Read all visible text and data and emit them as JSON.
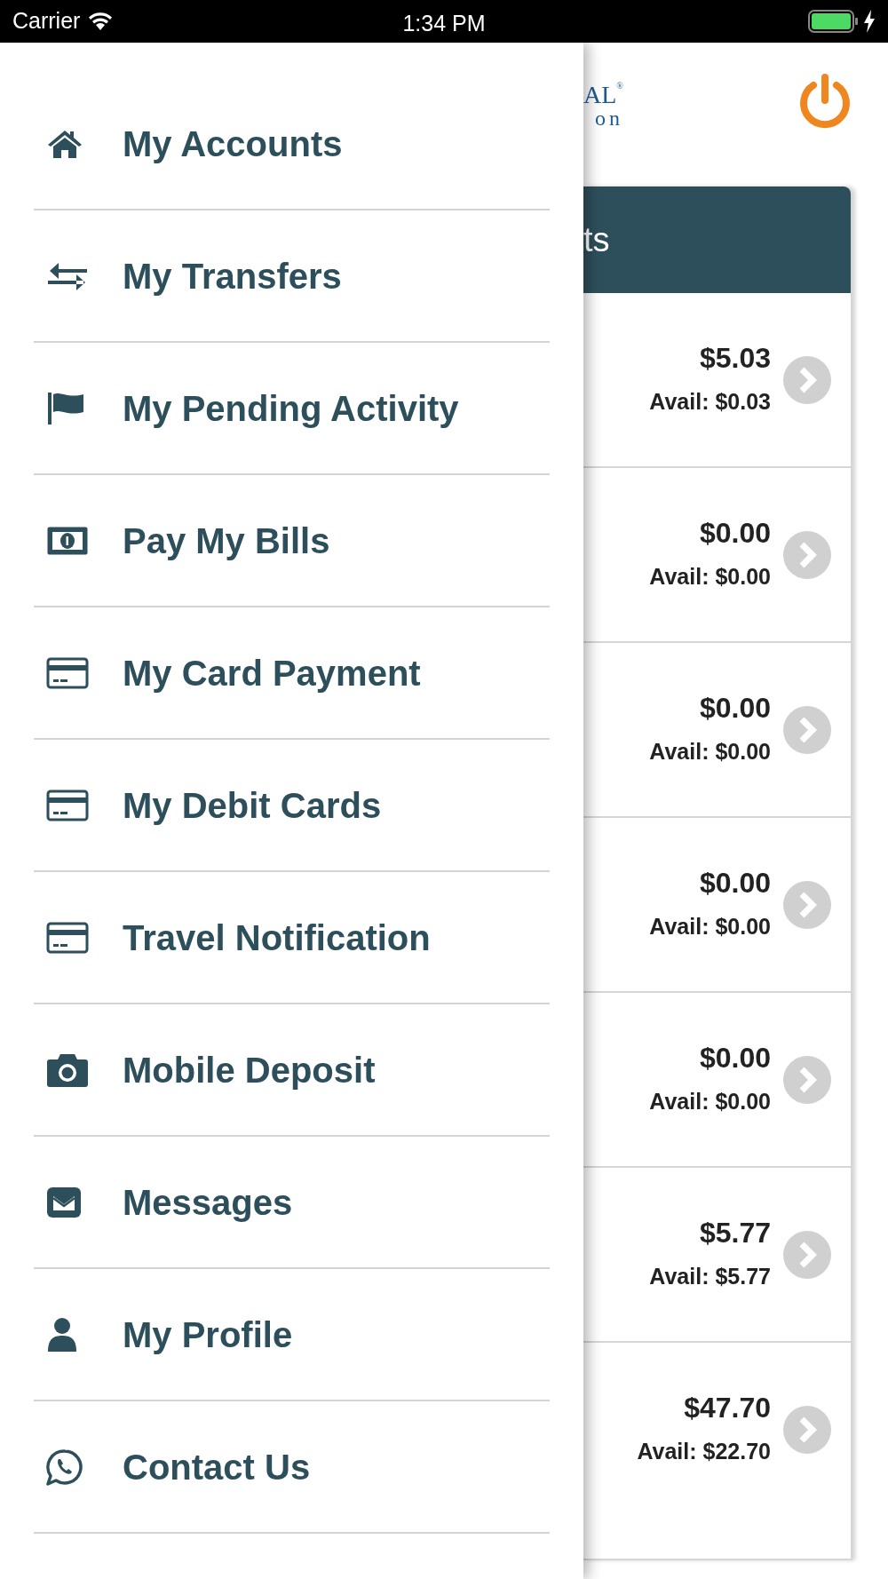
{
  "status_bar": {
    "carrier": "Carrier",
    "time": "1:34 PM"
  },
  "menu": [
    {
      "label": "My Accounts",
      "kind": "home"
    },
    {
      "label": "My Transfers",
      "kind": "transfer"
    },
    {
      "label": "My Pending Activity",
      "kind": "flag"
    },
    {
      "label": "Pay My Bills",
      "kind": "bill"
    },
    {
      "label": "My Card Payment",
      "kind": "card"
    },
    {
      "label": "My Debit Cards",
      "kind": "card"
    },
    {
      "label": "Travel Notification",
      "kind": "card"
    },
    {
      "label": "Mobile Deposit",
      "kind": "camera"
    },
    {
      "label": "Messages",
      "kind": "envelope"
    },
    {
      "label": "My Profile",
      "kind": "user"
    },
    {
      "label": "Contact Us",
      "kind": "chat"
    }
  ],
  "logo_partial": {
    "line_1": "AL$^{®}$",
    "line_2": "on"
  },
  "accounts_header": {
    "title_partial": "ts"
  },
  "accounts": [
    {
      "balance": "$5.03",
      "available": "Avail: $0.03"
    },
    {
      "balance": "$0.00",
      "available": "Avail: $0.00"
    },
    {
      "balance": "$0.00",
      "available": "Avail: $0.00"
    },
    {
      "balance": "$0.00",
      "available": "Avail: $0.00"
    },
    {
      "balance": "$0.00",
      "available": "Avail: $0.00"
    },
    {
      "balance": "$5.77",
      "available": "Avail: $5.77"
    },
    {
      "balance": "$47.70",
      "available": "Avail: $22.70"
    }
  ]
}
